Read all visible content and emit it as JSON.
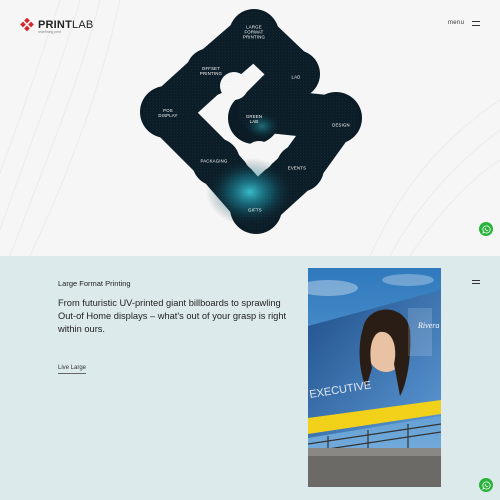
{
  "brand": {
    "name_bold": "PRINT",
    "name_light": "LAB",
    "tagline": "redefining print",
    "accent": "#d3272d"
  },
  "header": {
    "menu_label": "menu"
  },
  "hero": {
    "blob_color": "#0b1c26",
    "labels": {
      "large_format": "LARGE\nFORMAT\nPRINTING",
      "offset": "OFFSET\nPRINTING",
      "lad": "LAD",
      "pos": "POS\nDISPLAY",
      "green": "GREEN\nLAB",
      "design": "DESIGN",
      "packaging": "PACKAGING",
      "events": "EVENTS",
      "gifts": "GIFTS"
    }
  },
  "section": {
    "title": "Large Format Printing",
    "description": "From futuristic UV-printed giant billboards to sprawling Out-of Home displays – what's out of your grasp is right within ours.",
    "link": "Live Large",
    "photo": {
      "billboard_text": "EXECUTIVE",
      "billboard_side_text": "Rivera",
      "bg_sky": "#3f86c4"
    }
  },
  "whatsapp": {
    "icon": "whatsapp-icon",
    "color": "#29b43a"
  }
}
